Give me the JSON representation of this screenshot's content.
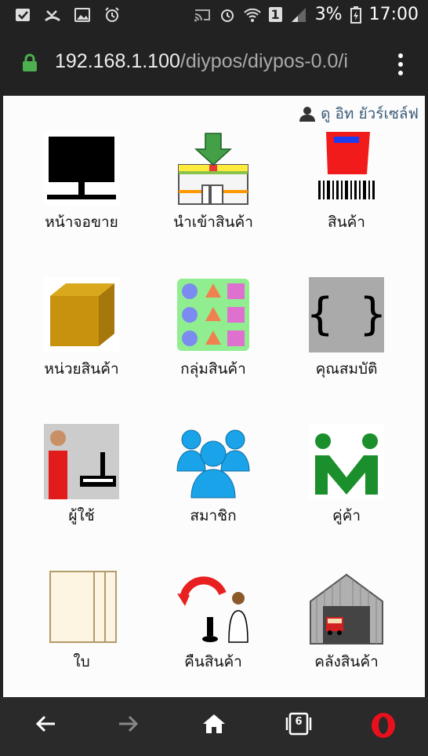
{
  "status": {
    "battery": "3%",
    "time": "17:00",
    "sim": "1"
  },
  "browser": {
    "url_main": "192.168.1.100",
    "url_rest": "/diypos/diypos-0.0/i",
    "tab_count": "6"
  },
  "user": {
    "name": "ดู อิท ยัวร์เซล์ฟ"
  },
  "tiles": [
    {
      "label": "หน้าจอขาย"
    },
    {
      "label": "นำเข้าสินค้า"
    },
    {
      "label": "สินค้า"
    },
    {
      "label": "หน่วยสินค้า"
    },
    {
      "label": "กลุ่มสินค้า"
    },
    {
      "label": "คุณสมบัติ"
    },
    {
      "label": "ผู้ใช้"
    },
    {
      "label": "สมาชิก"
    },
    {
      "label": "คู่ค้า"
    },
    {
      "label": "ใบ"
    },
    {
      "label": "คืนสินค้า"
    },
    {
      "label": "คลังสินค้า"
    }
  ]
}
